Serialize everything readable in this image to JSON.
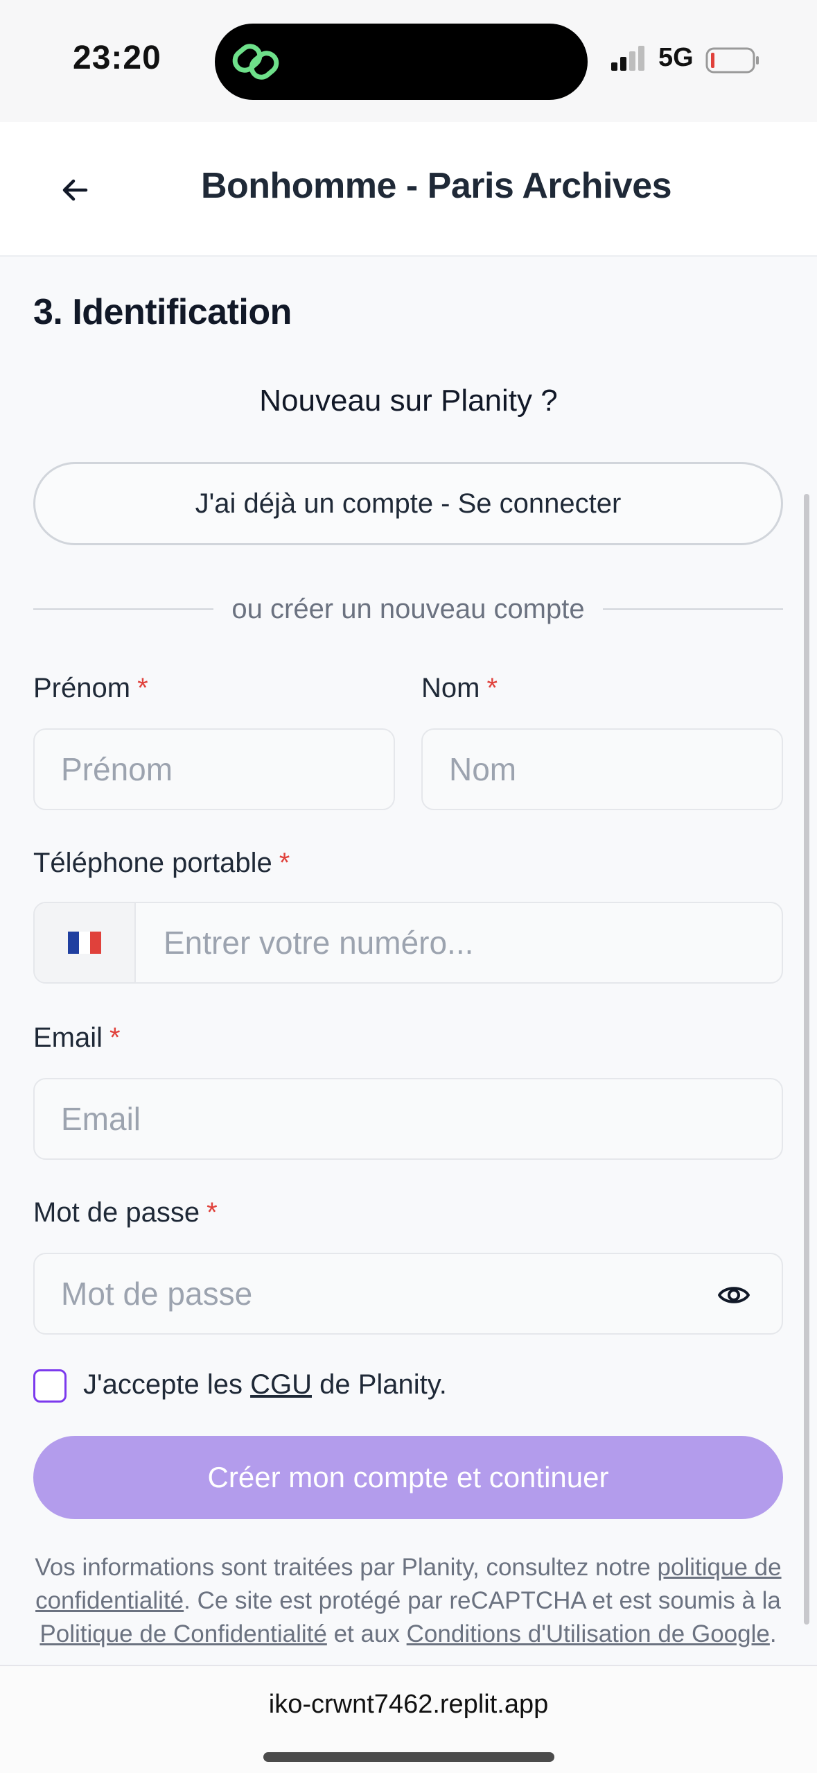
{
  "status_bar": {
    "time": "23:20",
    "network": "5G"
  },
  "header": {
    "title": "Bonhomme - Paris Archives"
  },
  "form": {
    "section_title": "3. Identification",
    "subtitle": "Nouveau sur Planity ?",
    "login_button": "J'ai déjà un compte - Se connecter",
    "divider_text": "ou créer un nouveau compte",
    "required_mark": "*",
    "first_name": {
      "label": "Prénom",
      "placeholder": "Prénom"
    },
    "last_name": {
      "label": "Nom",
      "placeholder": "Nom"
    },
    "phone": {
      "label": "Téléphone portable",
      "placeholder": "Entrer votre numéro...",
      "country_flag": "🇫🇷"
    },
    "email": {
      "label": "Email",
      "placeholder": "Email"
    },
    "password": {
      "label": "Mot de passe",
      "placeholder": "Mot de passe"
    },
    "terms": {
      "prefix": "J'accepte les ",
      "link": "CGU",
      "suffix": " de Planity."
    },
    "submit_button": "Créer mon compte et continuer",
    "legal": {
      "part1": "Vos informations sont traitées par Planity, consultez notre ",
      "link1": "politique de confidentialité",
      "part2": ". Ce site est protégé par reCAPTCHA et est soumis à la ",
      "link2": "Politique de Confidentialité",
      "part3": " et aux ",
      "link3": "Conditions d'Utilisation de Google",
      "part4": "."
    }
  },
  "browser": {
    "url": "iko-crwnt7462.replit.app"
  },
  "colors": {
    "accent": "#7c3aed",
    "submit_disabled": "#b39cec",
    "required": "#e0413b",
    "background": "#f8f9fb"
  }
}
